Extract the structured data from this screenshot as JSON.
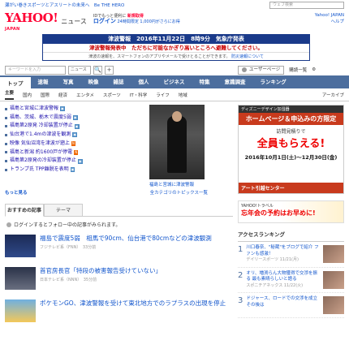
{
  "topstrip": {
    "left": "瀬がい巻きスポーツとアスリートの未来へ　Be THE HERO",
    "search_placeholder": "ウェブ検索"
  },
  "header": {
    "logo": "YAHOO!",
    "logo_sub": "JAPAN",
    "service": "ニュース",
    "tagline": "IDでもっと便利に",
    "register": "新規取得",
    "login": "ログイン",
    "points": "24時間限定 1,000円がさらにお得",
    "ytop": "Yahoo! JAPAN",
    "help": "ヘルプ"
  },
  "alert": {
    "title": "津波警報　2016年11月22日　8時9分　気象庁発表",
    "headline": "津波警報発表中　ただちに可能なかぎり高いところへ避難してください。",
    "note": "津波の速報を、スマートフォンのアプリやメールで受けとることができます。",
    "note_link": "防災速報について"
  },
  "toolbar": {
    "keyword_placeholder": "キーワードを入力",
    "select": "ニュース",
    "search_btn": "🔍",
    "add_btn": "+",
    "userpage": "ユーザーページ",
    "edit": "購読一覧",
    "settings": "⚙"
  },
  "nav": [
    "トップ",
    "速報",
    "写真",
    "映像",
    "雑誌",
    "個人",
    "ビジネス",
    "特集",
    "意識調査",
    "ランキング"
  ],
  "subnav": [
    "主要",
    "国内",
    "国際",
    "経済",
    "エンタメ",
    "スポーツ",
    "IT・科学",
    "ライフ",
    "地域"
  ],
  "subnav_archive": "アーカイブ",
  "topics": [
    {
      "text": "福島と宮城に津波警報",
      "tag": "cam"
    },
    {
      "text": "福島、茨城、栃木で震度5弱",
      "tag": "cam"
    },
    {
      "text": "福島第2原発 冷却装置が停止",
      "tag": "cam"
    },
    {
      "text": "仙台港で1.4mの津波を観測",
      "tag": "cam"
    },
    {
      "text": "映像 気仙沼湾を津波が遡上",
      "tag": "new"
    },
    {
      "text": "福島と新潟 約1600戸が停電",
      "tag": "new"
    },
    {
      "text": "福島第2原発の冷却装置が停止",
      "tag": "cam"
    },
    {
      "text": "トランプ氏 TPP離脱を表明",
      "tag": "cam"
    }
  ],
  "photo_caption": "福島と宮城に津波警報",
  "topics_more": "もっと見る",
  "topics_list": "全カテゴリのトピックス一覧",
  "tabs": [
    "おすすめの記事",
    "テーマ"
  ],
  "login_msg": "ログインするとフォロー中の記事がみられます。",
  "articles": [
    {
      "title": "福島で震度5弱　相馬で90cm、仙台港で80cmなどの津波観測",
      "meta": "フジテレビ系（FNN）　33分前"
    },
    {
      "title": "首官房長官「特段の被害報告受けていない」",
      "meta": "日本テレビ系（NNN）　35分前"
    },
    {
      "title": "ポケモンGO、津波警報を受けて東北地方でのラプラスの出現を停止",
      "meta": ""
    }
  ],
  "ad1": {
    "head": "ディズニーデザイン加湿器",
    "big": "ホームページ＆申込みの方限定",
    "visit": "訪問見積りで",
    "cash": "全員もらえる!",
    "date": "2016年10月1日(土)～12月30日(金)",
    "footer": "アート引越センター"
  },
  "ad2": {
    "brand": "YAHOO!トラベル",
    "text": "忘年会の予約はお早めに!"
  },
  "ranking": {
    "title": "アクセスランキング",
    "items": [
      {
        "n": "1",
        "text": "川口春奈、\"秘蔵\"をブログで紹介 ファンも感激！",
        "meta": "デイリースポーツ 11/21(月)"
      },
      {
        "n": "2",
        "text": "オリ、増渕らん大物獲得で交渉を振る 最も素晴らしいと語る",
        "meta": "スポニチアネックス 11/22(火)"
      },
      {
        "n": "3",
        "text": "ドジャース、ロードでの交渉を成立 その後は",
        "meta": ""
      }
    ]
  },
  "colors": {
    "nav": "#4c6e9e",
    "alert": "#1a3a8a",
    "brand": "#ff0033"
  }
}
